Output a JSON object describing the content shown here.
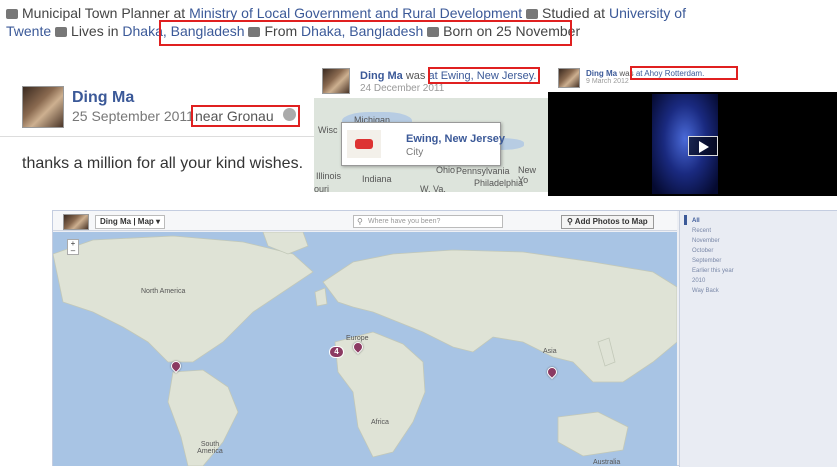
{
  "profile_info": {
    "work_prefix": "Municipal Town Planner at",
    "work_org": "Ministry of Local Government and Rural Development",
    "studied_prefix": "Studied at",
    "school": "University of Twente",
    "lives_prefix": "Lives in",
    "lives_city": "Dhaka, Bangladesh",
    "from_prefix": "From",
    "from_city": "Dhaka, Bangladesh",
    "born": "Born on 25 November"
  },
  "post": {
    "author": "Ding Ma",
    "date": "25 September 2011",
    "place": "near Gronau",
    "text": "thanks a million for all your kind wishes."
  },
  "checkin_1": {
    "author": "Ding Ma",
    "verb": "was",
    "location": "at Ewing, New Jersey.",
    "date": "24 December 2011",
    "card_title": "Ewing, New Jersey",
    "card_subtitle": "City",
    "map_labels": [
      "Michigan",
      "Wisc",
      "Illinois",
      "Indiana",
      "Ohio",
      "Pennsylvania",
      "New Yo",
      "Philadelphia",
      "W. Va.",
      "ouri"
    ]
  },
  "checkin_2": {
    "author": "Ding Ma",
    "verb": "was",
    "location": "at Ahoy Rotterdam.",
    "date": "9 March 2012"
  },
  "map_view": {
    "author": "Ding Ma",
    "view_selector": "Map",
    "search_placeholder": "Where have you been?",
    "add_photos": "Add Photos to Map",
    "zoom_label": "+",
    "continents": {
      "north_america": "North America",
      "europe": "Europe",
      "asia": "Asia",
      "africa": "Africa",
      "south_america": "South America",
      "australia": "Australia"
    },
    "cluster_count": "4",
    "filters": [
      "All",
      "Recent",
      "November",
      "October",
      "September",
      "Earlier this year",
      "2010",
      "Way Back"
    ]
  },
  "colors": {
    "link": "#3b5998",
    "highlight_box": "#e02020",
    "pin": "#8b3a62",
    "ocean": "#a8c4e4",
    "land": "#dfe3d6"
  }
}
